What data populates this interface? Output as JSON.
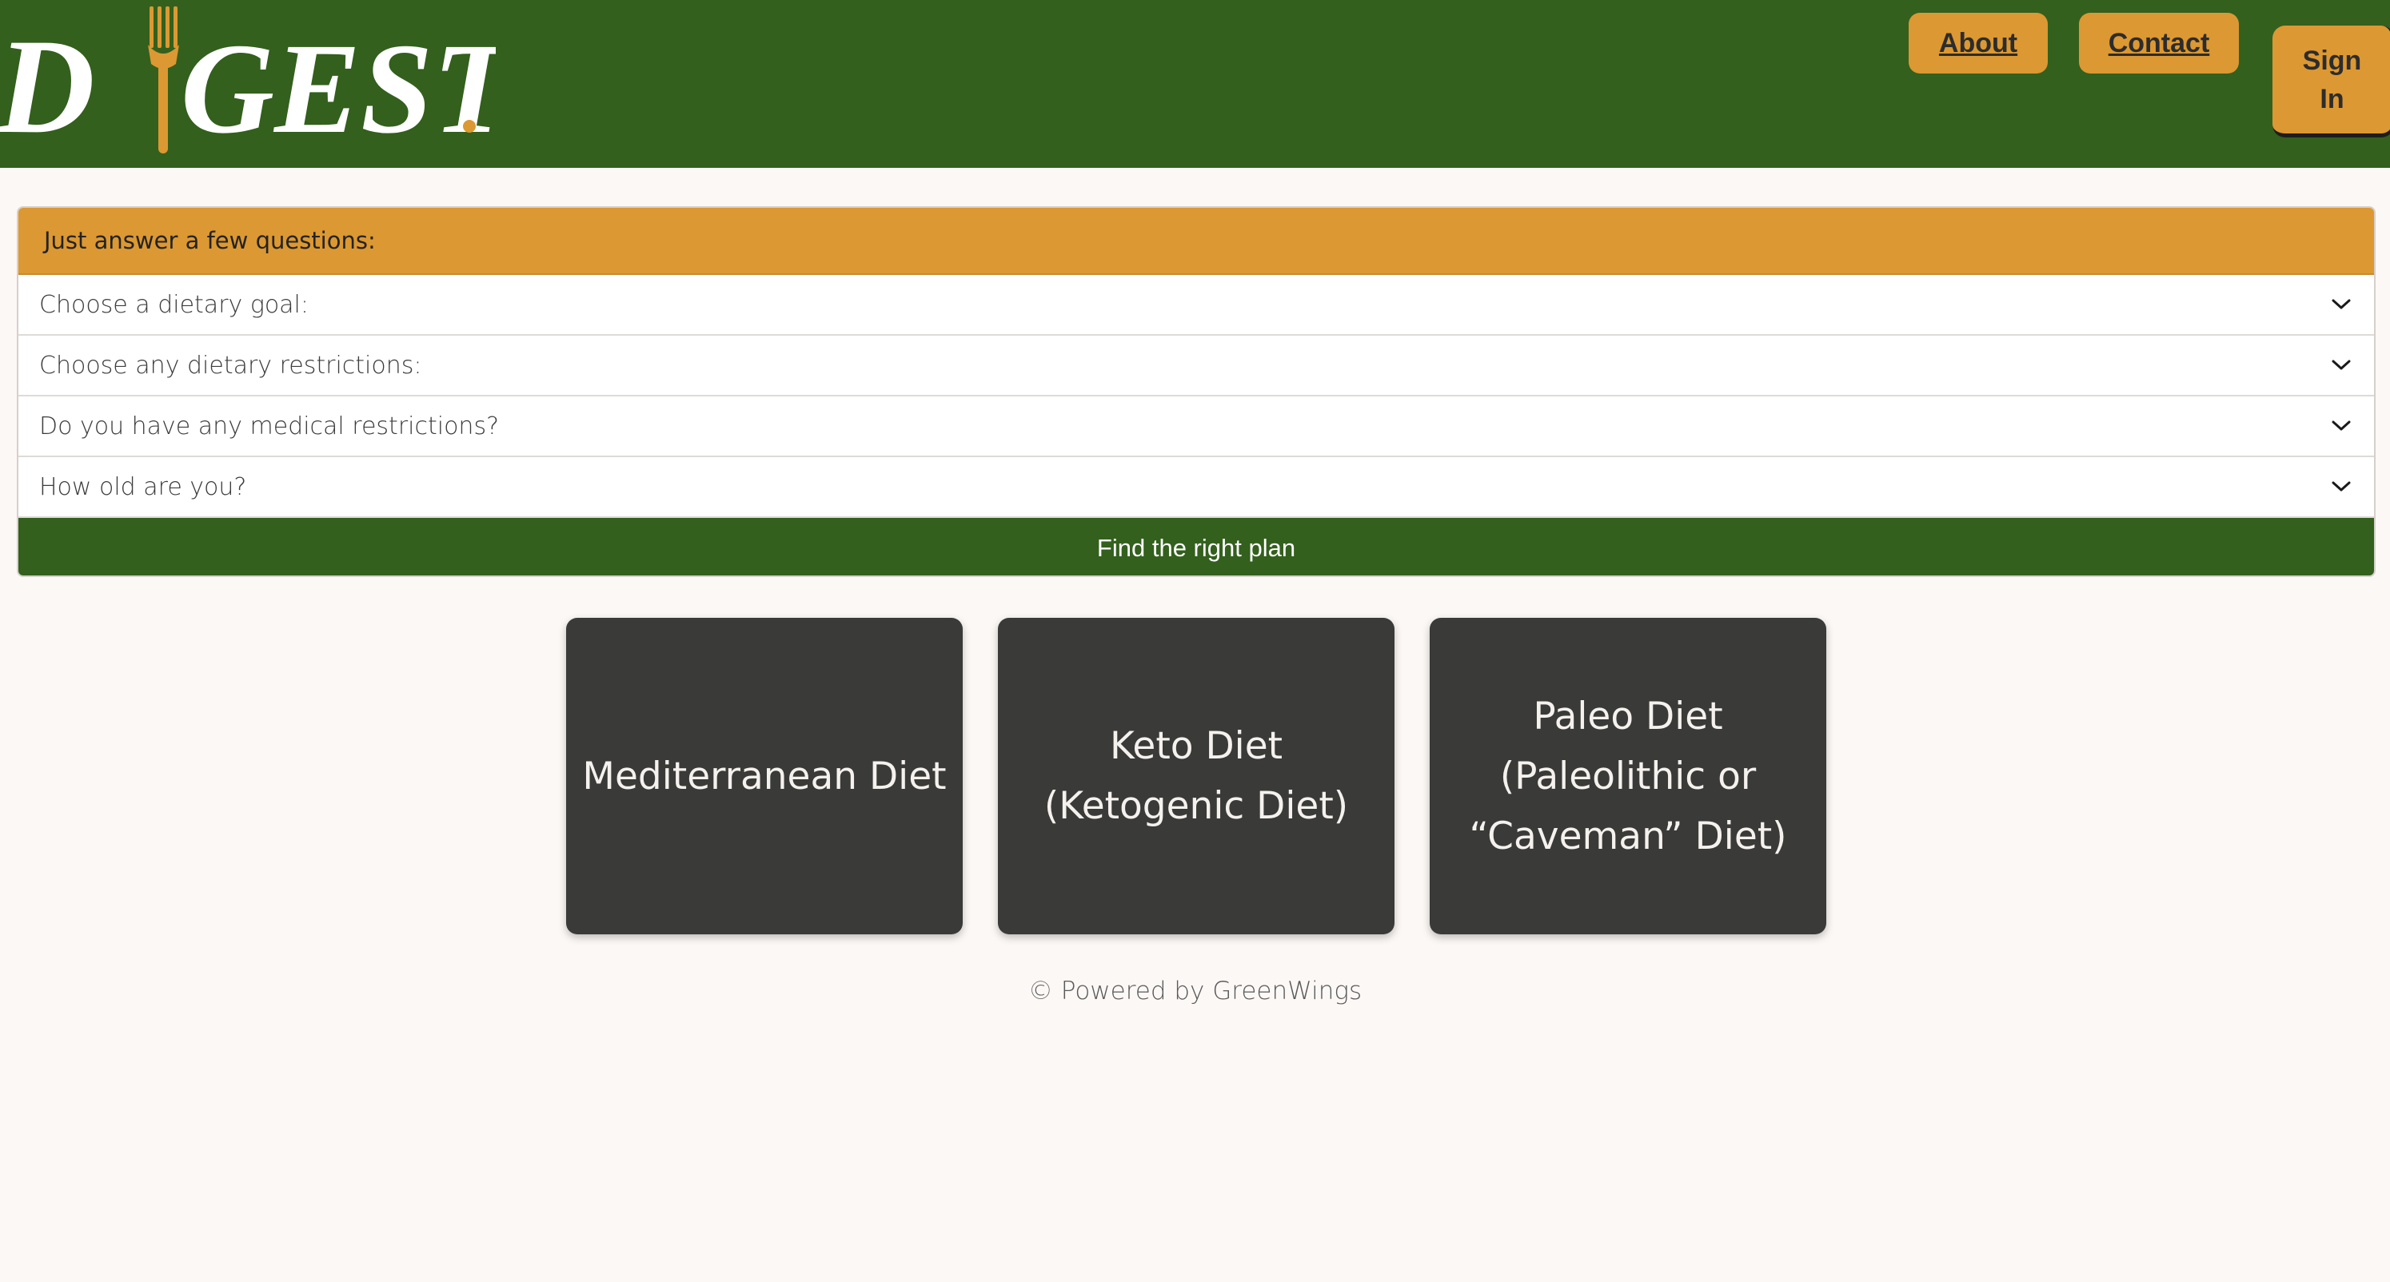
{
  "header": {
    "logo_text": "DIGEST.",
    "nav": {
      "about": "About",
      "contact": "Contact",
      "sign_in": "Sign In"
    }
  },
  "questionnaire": {
    "heading": "Just answer a few questions:",
    "questions": [
      {
        "label": "Choose a dietary goal:"
      },
      {
        "label": "Choose any dietary restrictions:"
      },
      {
        "label": "Do you have any medical restrictions?"
      },
      {
        "label": "How old are you?"
      }
    ],
    "submit_label": "Find the right plan"
  },
  "diets": [
    {
      "title": "Mediterranean Diet"
    },
    {
      "title": "Keto Diet (Ketogenic Diet)"
    },
    {
      "title": "Paleo Diet (Paleolithic or “Caveman” Diet)"
    }
  ],
  "footer": {
    "text": "© Powered by GreenWings"
  },
  "colors": {
    "header_green": "#33601d",
    "accent_orange": "#dc9832",
    "card_dark": "#3a3a38",
    "page_background": "#fcf8f6"
  },
  "icons": {
    "dropdown": "chevron-down-icon",
    "logo_fork": "fork-icon"
  }
}
